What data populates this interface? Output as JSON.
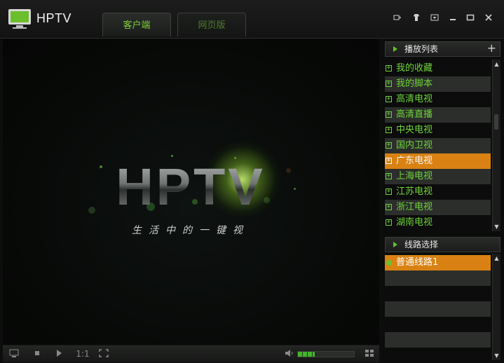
{
  "app": {
    "title": "HPTV"
  },
  "tabs": [
    {
      "label": "客户端",
      "active": true
    },
    {
      "label": "网页版",
      "active": false
    }
  ],
  "window_controls": [
    "mini-mode-icon",
    "skin-icon",
    "menu-icon",
    "minimize-icon",
    "maximize-icon",
    "close-icon"
  ],
  "player": {
    "logo_text": "HPTV",
    "tagline": "生活中的一键视"
  },
  "bottom_controls": {
    "ratio_label": "1:1",
    "volume_level": 0.3
  },
  "playlist": {
    "header": "播放列表",
    "add_symbol": "+",
    "items": [
      {
        "label": "我的收藏",
        "expander": "+"
      },
      {
        "label": "我的脚本",
        "expander": "+"
      },
      {
        "label": "高清电视",
        "expander": "+"
      },
      {
        "label": "高清直播",
        "expander": "+"
      },
      {
        "label": "中央电视",
        "expander": "+"
      },
      {
        "label": "国内卫视",
        "expander": "+"
      },
      {
        "label": "广东电视",
        "expander": "+",
        "selected": true
      },
      {
        "label": "上海电视",
        "expander": "+"
      },
      {
        "label": "江苏电视",
        "expander": "+"
      },
      {
        "label": "浙江电视",
        "expander": "+"
      },
      {
        "label": "湖南电视",
        "expander": "+"
      }
    ]
  },
  "routes": {
    "header": "线路选择",
    "items": [
      {
        "label": "普通线路1",
        "selected": true
      }
    ]
  },
  "colors": {
    "accent_green": "#6fd43a",
    "selection_orange": "#d98213",
    "background": "#0c0d0c"
  }
}
